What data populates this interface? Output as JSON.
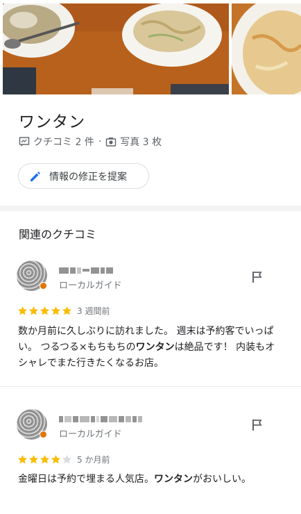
{
  "place": {
    "title": "ワンタン",
    "reviews_count_label": "クチコミ 2 件",
    "separator": "·",
    "photos_count_label": "写真 3 枚",
    "suggest_edit_label": "情報の修正を提案"
  },
  "section": {
    "title": "関連のクチコミ"
  },
  "reviews": [
    {
      "role": "ローカルガイド",
      "rating": 5,
      "time": "3 週間前",
      "text_parts": [
        "数か月前に久しぶりに訪れました。 週末は予約客でいっぱい。 つるつる×もちもちの",
        "ワンタン",
        "は絶品です！ 内装もオシャレでまた行きたくなるお店。"
      ]
    },
    {
      "role": "ローカルガイド",
      "rating": 4,
      "time": "5 か月前",
      "text_parts": [
        "金曜日は予約で埋まる人気店。",
        "ワンタン",
        "がおいしい。"
      ]
    }
  ],
  "colors": {
    "star": "#fbbc04",
    "star_empty": "#dadce0",
    "accent_blue": "#1a73e8",
    "guide_badge": "#e37400"
  },
  "icons": {
    "reviews": "review-icon",
    "photos": "camera-icon",
    "suggest": "pencil-icon",
    "report": "flag-icon"
  }
}
